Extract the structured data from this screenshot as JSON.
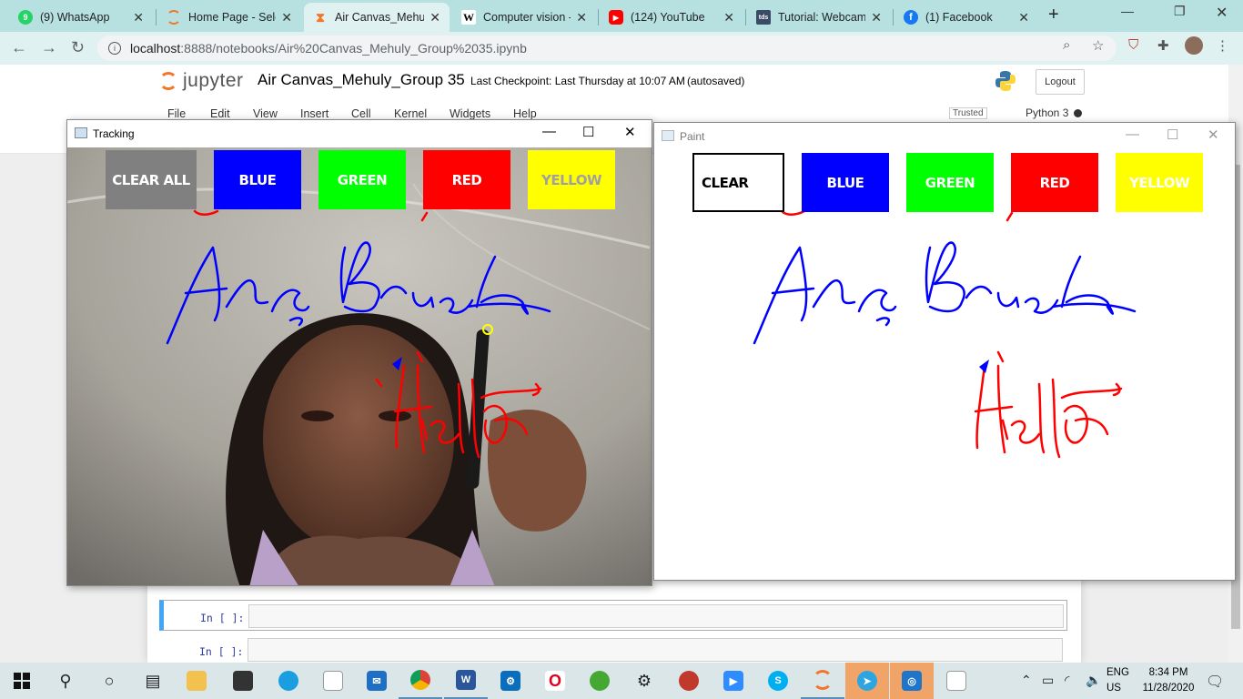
{
  "browser": {
    "tabs": [
      {
        "title": "(9) WhatsApp",
        "favicon": "whatsapp-icon",
        "color": "#25d366"
      },
      {
        "title": "Home Page - Sele",
        "favicon": "jupyter-icon",
        "color": "#f37626"
      },
      {
        "title": "Air Canvas_Mehuly",
        "favicon": "hourglass-icon",
        "color": "#f37626",
        "active": true
      },
      {
        "title": "Computer vision -",
        "favicon": "wikipedia-icon",
        "color": "#000000"
      },
      {
        "title": "(124) YouTube",
        "favicon": "youtube-icon",
        "color": "#ff0000"
      },
      {
        "title": "Tutorial: Webcam",
        "favicon": "tds-icon",
        "color": "#3b4a66"
      },
      {
        "title": "(1) Facebook",
        "favicon": "facebook-icon",
        "color": "#1877f2"
      }
    ],
    "url": {
      "host": "localhost",
      "rest": ":8888/notebooks/Air%20Canvas_Mehuly_Group%2035.ipynb"
    }
  },
  "jupyter": {
    "logo_text": "jupyter",
    "notebook_title": "Air Canvas_Mehuly_Group 35",
    "checkpoint": "Last Checkpoint: Last Thursday at 10:07 AM",
    "autosaved": "(autosaved)",
    "logout": "Logout",
    "menu": [
      "File",
      "Edit",
      "View",
      "Insert",
      "Cell",
      "Kernel",
      "Widgets",
      "Help"
    ],
    "trusted": "Trusted",
    "kernel": "Python 3",
    "cells": [
      {
        "prompt": "In [ ]:"
      },
      {
        "prompt": "In [ ]:"
      }
    ]
  },
  "tracking_window": {
    "title": "Tracking",
    "buttons": [
      {
        "label": "CLEAR ALL",
        "bg": "#808080",
        "fg": "#ffffff"
      },
      {
        "label": "BLUE",
        "bg": "#0000ff",
        "fg": "#ffffff"
      },
      {
        "label": "GREEN",
        "bg": "#00ff00",
        "fg": "#ffffff"
      },
      {
        "label": "RED",
        "bg": "#ff0000",
        "fg": "#ffffff"
      },
      {
        "label": "YELLOW",
        "bg": "#ffff00",
        "fg": "#a0a0a0"
      }
    ]
  },
  "paint_window": {
    "title": "Paint",
    "buttons": [
      {
        "label": "CLEAR",
        "bg": "#ffffff",
        "fg": "#000000"
      },
      {
        "label": "BLUE",
        "bg": "#0000ff",
        "fg": "#ffffff"
      },
      {
        "label": "GREEN",
        "bg": "#00ff00",
        "fg": "#ffffff"
      },
      {
        "label": "RED",
        "bg": "#ff0000",
        "fg": "#ffffff"
      },
      {
        "label": "YELLOW",
        "bg": "#ffff00",
        "fg": "#ffffff"
      }
    ]
  },
  "drawing": {
    "word1": "Air Brush",
    "word2": "Hello",
    "stroke_blue": "#0000ff",
    "stroke_red": "#ff0000"
  },
  "taskbar": {
    "lang": {
      "l1": "ENG",
      "l2": "US"
    },
    "time": "8:34 PM",
    "date": "11/28/2020"
  }
}
